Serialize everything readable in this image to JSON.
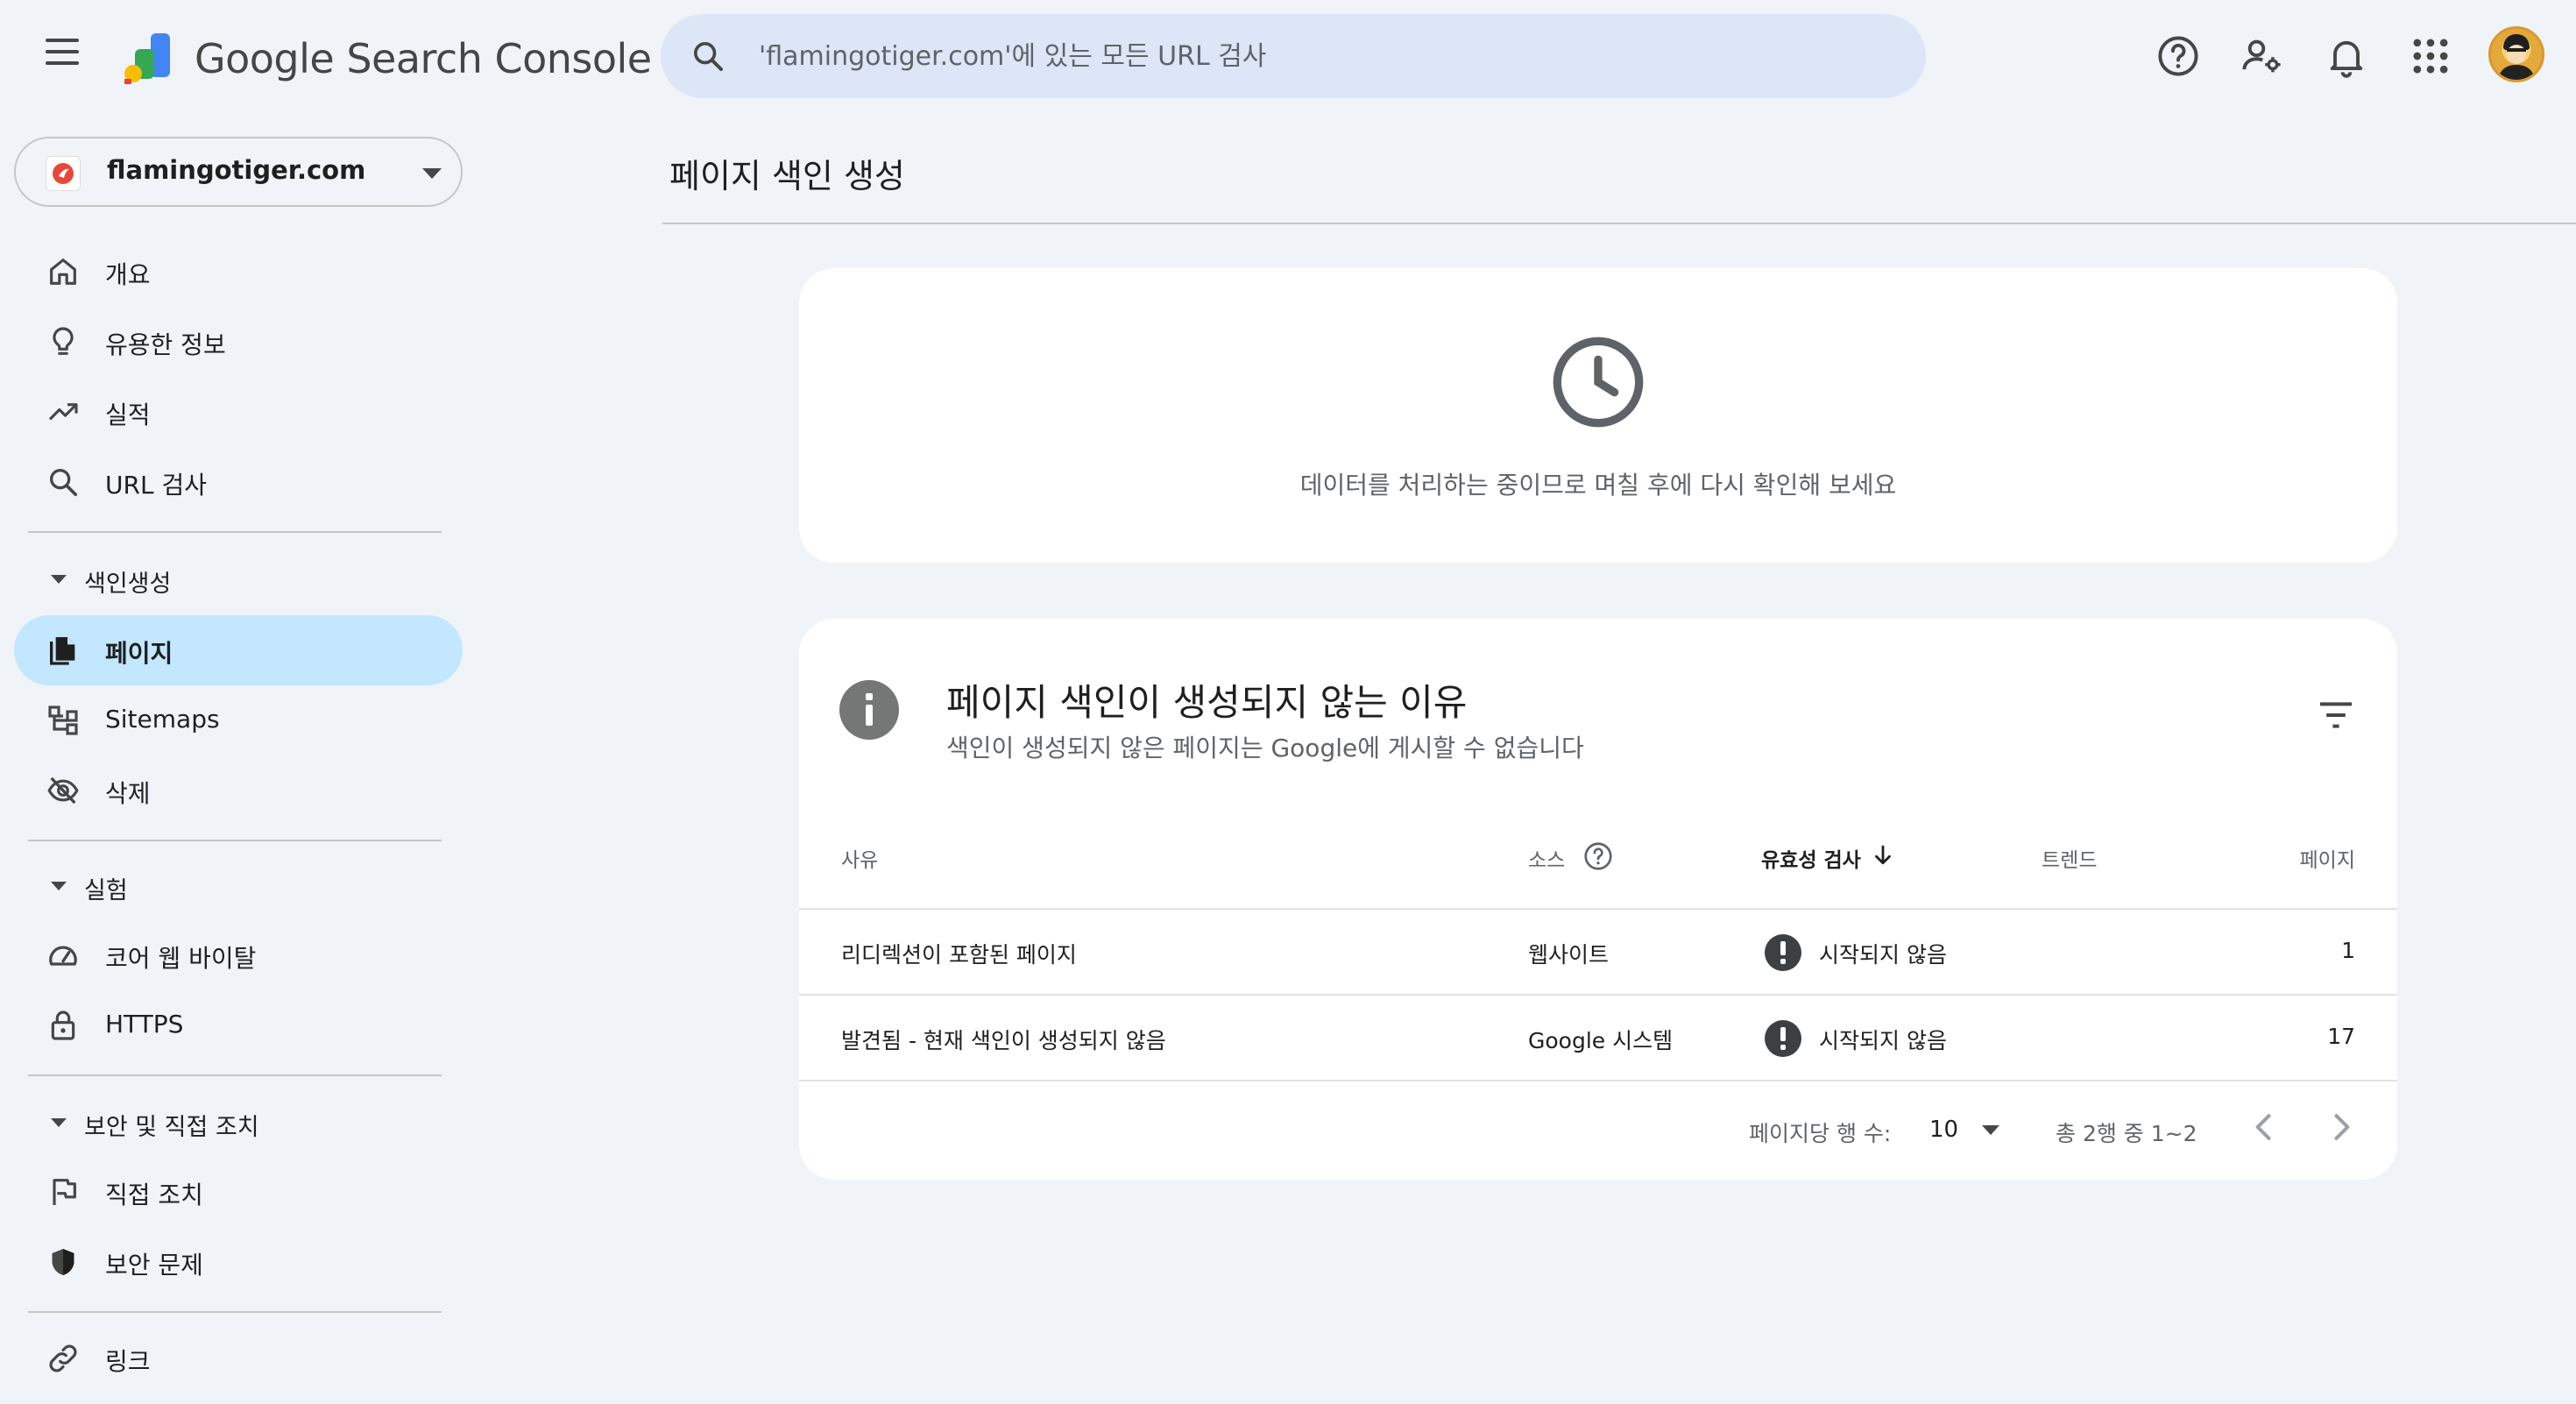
{
  "app": {
    "product_name": "Google Search Console",
    "search_placeholder": "'flamingotiger.com'에 있는 모든 URL 검사"
  },
  "property": {
    "name": "flamingotiger.com"
  },
  "sidebar": {
    "items": [
      {
        "label": "개요",
        "icon": "home-icon"
      },
      {
        "label": "유용한 정보",
        "icon": "lightbulb-icon"
      },
      {
        "label": "실적",
        "icon": "trending-up-icon"
      },
      {
        "label": "URL 검사",
        "icon": "search-icon"
      }
    ],
    "sections": [
      {
        "label": "색인생성",
        "items": [
          {
            "label": "페이지",
            "icon": "pages-icon",
            "active": true
          },
          {
            "label": "Sitemaps",
            "icon": "sitemap-icon"
          },
          {
            "label": "삭제",
            "icon": "visibility-off-icon"
          }
        ]
      },
      {
        "label": "실험",
        "items": [
          {
            "label": "코어 웹 바이탈",
            "icon": "speed-icon"
          },
          {
            "label": "HTTPS",
            "icon": "lock-icon"
          }
        ]
      },
      {
        "label": "보안 및 직접 조치",
        "items": [
          {
            "label": "직접 조치",
            "icon": "flag-icon"
          },
          {
            "label": "보안 문제",
            "icon": "shield-icon"
          }
        ]
      }
    ],
    "links_label": "링크"
  },
  "main": {
    "page_title": "페이지 색인 생성",
    "processing_message": "데이터를 처리하는 중이므로 며칠 후에 다시 확인해 보세요",
    "reasons_card": {
      "title": "페이지 색인이 생성되지 않는 이유",
      "subtitle": "색인이 생성되지 않은 페이지는 Google에 게시할 수 없습니다",
      "columns": {
        "reason": "사유",
        "source": "소스",
        "validation": "유효성 검사",
        "trend": "트렌드",
        "pages": "페이지"
      },
      "rows": [
        {
          "reason": "리디렉션이 포함된 페이지",
          "source": "웹사이트",
          "validation": "시작되지 않음",
          "pages": "1"
        },
        {
          "reason": "발견됨 - 현재 색인이 생성되지 않음",
          "source": "Google 시스템",
          "validation": "시작되지 않음",
          "pages": "17"
        }
      ],
      "pagination": {
        "rows_per_page_label": "페이지당 행 수:",
        "rows_per_page": "10",
        "range": "총 2행 중 1~2"
      }
    }
  },
  "colors": {
    "background": "#f0f4f9",
    "active_nav": "#c2e7ff",
    "search_bg": "#dde6f6",
    "card_bg": "#ffffff"
  }
}
